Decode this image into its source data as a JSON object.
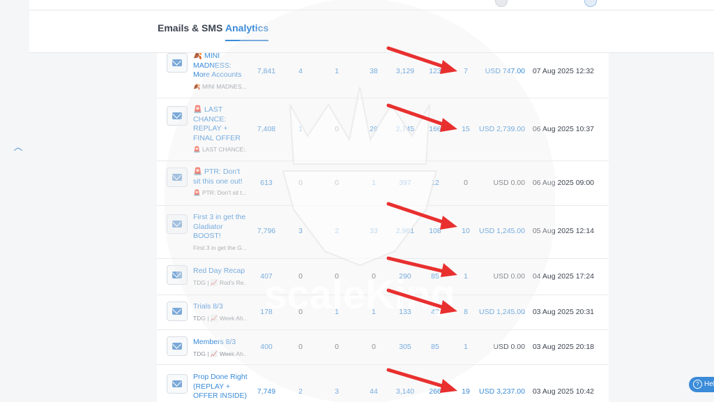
{
  "tabs": [
    {
      "label": "Emails & SMS",
      "active": false
    },
    {
      "label": "Analytics",
      "active": true
    }
  ],
  "rows": [
    {
      "icon": "envelope-icon",
      "name": "🍂 MINI MADNESS: More Accounts",
      "preview": "🍂 MINI MADNES...",
      "delivered": "7,841",
      "c2": "4",
      "c3": "1",
      "c4": "38",
      "c5": "3,129",
      "c6": "123",
      "orders": "7",
      "revenue": "USD 747.00",
      "date": "07 Aug 2025 12:32"
    },
    {
      "icon": "envelope-icon",
      "name": "🚨 LAST CHANCE: REPLAY + FINAL OFFER",
      "preview": "🚨 LAST CHANCE:...",
      "delivered": "7,408",
      "c2": "1",
      "c3": "0",
      "c4": "29",
      "c5": "2,745",
      "c6": "166",
      "orders": "15",
      "revenue": "USD 2,739.00",
      "date": "06 Aug 2025 10:37"
    },
    {
      "icon": "envelope-icon",
      "name": "🚨 PTR: Don't sit this one out!",
      "preview": "🚨 PTR: Don't sit t...",
      "delivered": "613",
      "c2": "0",
      "c3": "0",
      "c4": "1",
      "c5": "397",
      "c6": "12",
      "orders": "0",
      "revenue": "USD 0.00",
      "date": "06 Aug 2025 09:00"
    },
    {
      "icon": "envelope-icon",
      "name": "First 3 in get the Gladiator BOOST!",
      "preview": "First 3 in get the G...",
      "delivered": "7,796",
      "c2": "3",
      "c3": "2",
      "c4": "33",
      "c5": "2,961",
      "c6": "108",
      "orders": "10",
      "revenue": "USD 1,245.00",
      "date": "05 Aug 2025 12:14"
    },
    {
      "icon": "envelope-icon",
      "name": "Red Day Recap",
      "preview": "TDG | 📈 Rod's Re...",
      "delivered": "407",
      "c2": "0",
      "c3": "0",
      "c4": "0",
      "c5": "290",
      "c6": "85",
      "orders": "1",
      "revenue": "USD 0.00",
      "date": "04 Aug 2025 17:24"
    },
    {
      "icon": "envelope-icon",
      "name": "Trials 8/3",
      "preview": "TDG | 📈 Week Ah...",
      "delivered": "178",
      "c2": "0",
      "c3": "1",
      "c4": "1",
      "c5": "133",
      "c6": "42",
      "orders": "8",
      "revenue": "USD 1,245.00",
      "date": "03 Aug 2025 20:31"
    },
    {
      "icon": "envelope-icon",
      "name": "Members 8/3",
      "preview": "TDG | 📈 Week Ah...",
      "delivered": "400",
      "c2": "0",
      "c3": "0",
      "c4": "0",
      "c5": "305",
      "c6": "85",
      "orders": "1",
      "revenue": "USD 0.00",
      "date": "03 Aug 2025 20:18"
    },
    {
      "icon": "envelope-icon",
      "name": "Prop Done Right (REPLAY + OFFER INSIDE)",
      "preview": "",
      "delivered": "7,749",
      "c2": "2",
      "c3": "3",
      "c4": "44",
      "c5": "3,140",
      "c6": "266",
      "orders": "19",
      "revenue": "USD 3,237.00",
      "date": "03 Aug 2025 10:42"
    }
  ],
  "watermark": {
    "text": "scaleKing"
  },
  "help": {
    "label": "Help"
  },
  "icons": {
    "sidebar_toggle": "chevron-up-icon",
    "annotation": "red-arrow-icon"
  },
  "colors": {
    "accent": "#3a8bd8",
    "arrow": "#e8302f"
  }
}
